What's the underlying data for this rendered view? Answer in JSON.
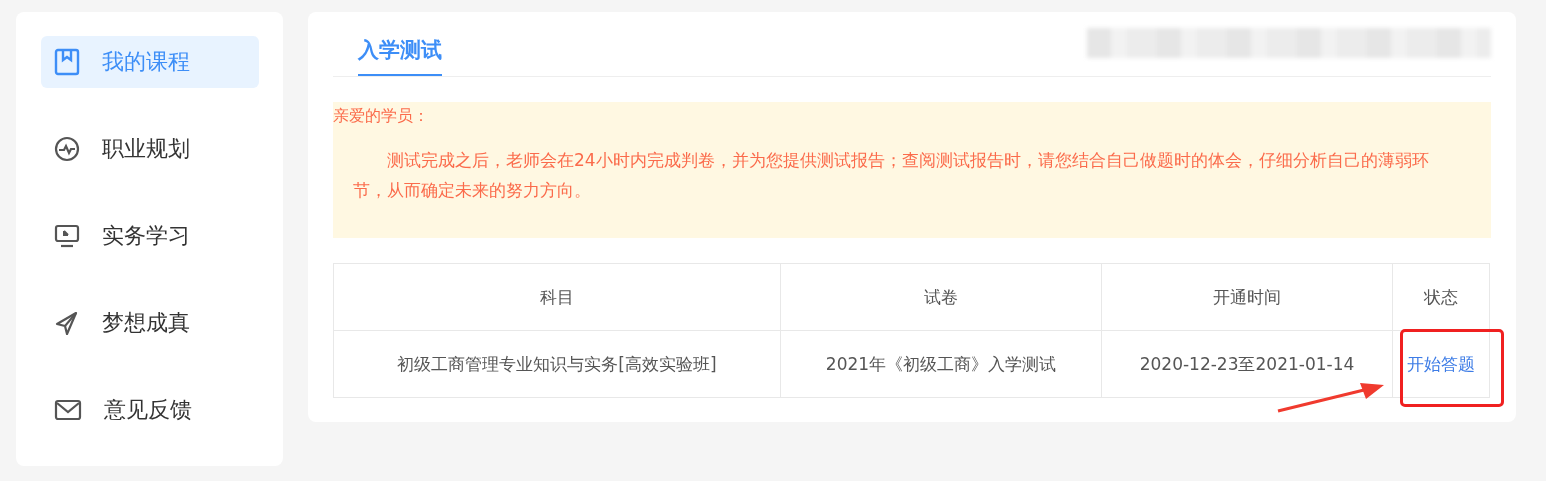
{
  "sidebar": {
    "items": [
      {
        "label": "我的课程",
        "selected": true
      },
      {
        "label": "职业规划",
        "selected": false
      },
      {
        "label": "实务学习",
        "selected": false
      },
      {
        "label": "梦想成真",
        "selected": false
      },
      {
        "label": "意见反馈",
        "selected": false
      }
    ]
  },
  "tabs": [
    {
      "label": "入学测试",
      "selected": true
    }
  ],
  "notice": {
    "greeting": "亲爱的学员：",
    "body": "测试完成之后，老师会在24小时内完成判卷，并为您提供测试报告；查阅测试报告时，请您结合自己做题时的体会，仔细分析自己的薄弱环节，从而确定未来的努力方向。"
  },
  "table": {
    "columns": [
      "科目",
      "试卷",
      "开通时间",
      "状态"
    ],
    "rows": [
      {
        "subject": "初级工商管理专业知识与实务[高效实验班]",
        "paper": "2021年《初级工商》入学测试",
        "period": "2020-12-23至2021-01-14",
        "action": "开始答题"
      }
    ]
  }
}
